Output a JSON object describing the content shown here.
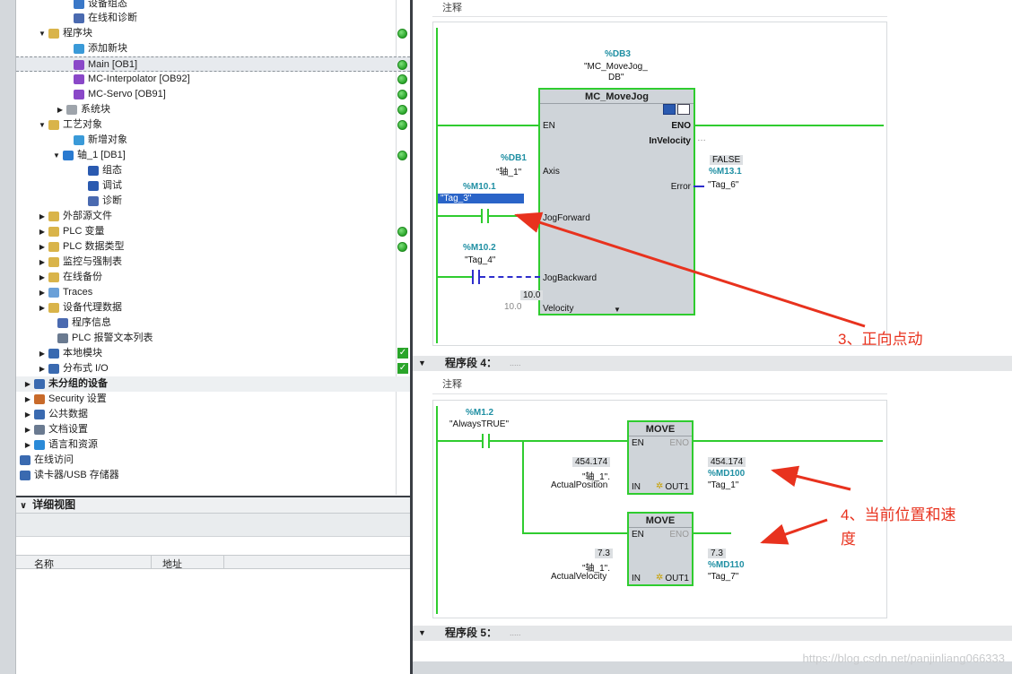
{
  "tree": {
    "items": [
      {
        "label": "设备组态",
        "twisty": "",
        "dot": "",
        "icon": "device-config-icon",
        "icolor": "#3a78c8"
      },
      {
        "label": "在线和诊断",
        "twisty": "",
        "dot": "",
        "icon": "online-diagnostics-icon",
        "icolor": "#4a6ab0"
      },
      {
        "label": "程序块",
        "twisty": "▼",
        "dot": "green",
        "icon": "folder-icon",
        "icolor": "#d9b44a"
      },
      {
        "label": "添加新块",
        "twisty": "",
        "dot": "",
        "icon": "add-block-icon",
        "icolor": "#3a9ad8"
      },
      {
        "label": "Main [OB1]",
        "twisty": "",
        "dot": "green",
        "icon": "ob-block-icon",
        "icolor": "#8a48c8",
        "selected": true
      },
      {
        "label": "MC-Interpolator [OB92]",
        "twisty": "",
        "dot": "green",
        "icon": "ob-block-icon",
        "icolor": "#8a48c8"
      },
      {
        "label": "MC-Servo [OB91]",
        "twisty": "",
        "dot": "green",
        "icon": "ob-block-icon",
        "icolor": "#8a48c8"
      },
      {
        "label": "系统块",
        "twisty": "▶",
        "dot": "green",
        "icon": "folder-icon",
        "icolor": "#9ea4ab"
      },
      {
        "label": "工艺对象",
        "twisty": "▼",
        "dot": "green",
        "icon": "folder-icon",
        "icolor": "#d9b44a"
      },
      {
        "label": "新增对象",
        "twisty": "",
        "dot": "",
        "icon": "add-object-icon",
        "icolor": "#3a9ad8"
      },
      {
        "label": "轴_1 [DB1]",
        "twisty": "▼",
        "dot": "green",
        "icon": "axis-icon",
        "icolor": "#2a7ad0"
      },
      {
        "label": "组态",
        "twisty": "",
        "dot": "",
        "icon": "config-icon",
        "icolor": "#2a5ab0"
      },
      {
        "label": "调试",
        "twisty": "",
        "dot": "",
        "icon": "commissioning-icon",
        "icolor": "#2a5ab0"
      },
      {
        "label": "诊断",
        "twisty": "",
        "dot": "",
        "icon": "diagnostics-icon",
        "icolor": "#4a6ab0"
      },
      {
        "label": "外部源文件",
        "twisty": "▶",
        "dot": "",
        "icon": "folder-icon",
        "icolor": "#d9b44a"
      },
      {
        "label": "PLC 变量",
        "twisty": "▶",
        "dot": "green",
        "icon": "folder-icon",
        "icolor": "#d9b44a"
      },
      {
        "label": "PLC 数据类型",
        "twisty": "▶",
        "dot": "green",
        "icon": "folder-icon",
        "icolor": "#d9b44a"
      },
      {
        "label": "监控与强制表",
        "twisty": "▶",
        "dot": "",
        "icon": "folder-icon",
        "icolor": "#d9b44a"
      },
      {
        "label": "在线备份",
        "twisty": "▶",
        "dot": "",
        "icon": "folder-icon",
        "icolor": "#d9b44a"
      },
      {
        "label": "Traces",
        "twisty": "▶",
        "dot": "",
        "icon": "folder-icon",
        "icolor": "#6aa0d8"
      },
      {
        "label": "设备代理数据",
        "twisty": "▶",
        "dot": "",
        "icon": "folder-icon",
        "icolor": "#d9b44a"
      },
      {
        "label": "程序信息",
        "twisty": "",
        "dot": "",
        "icon": "program-info-icon",
        "icolor": "#4a6ab0"
      },
      {
        "label": "PLC 报警文本列表",
        "twisty": "",
        "dot": "",
        "icon": "alarm-text-icon",
        "icolor": "#6a7a90"
      },
      {
        "label": "本地模块",
        "twisty": "▶",
        "dot": "check",
        "icon": "folder-icon",
        "icolor": "#3a6ab0"
      },
      {
        "label": "分布式 I/O",
        "twisty": "▶",
        "dot": "check",
        "icon": "folder-icon",
        "icolor": "#3a6ab0"
      },
      {
        "label": "未分组的设备",
        "twisty": "▶",
        "dot": "",
        "icon": "ungrouped-devices-icon",
        "icolor": "#3a6ab0",
        "bold": true,
        "group": true
      },
      {
        "label": "Security 设置",
        "twisty": "▶",
        "dot": "",
        "icon": "security-icon",
        "icolor": "#c86a2a"
      },
      {
        "label": "公共数据",
        "twisty": "▶",
        "dot": "",
        "icon": "common-data-icon",
        "icolor": "#3a6ab0"
      },
      {
        "label": "文档设置",
        "twisty": "▶",
        "dot": "",
        "icon": "document-icon",
        "icolor": "#6a7a90"
      },
      {
        "label": "语言和资源",
        "twisty": "▶",
        "dot": "",
        "icon": "language-icon",
        "icolor": "#2a8ad8"
      },
      {
        "label": "在线访问",
        "twisty": "▶",
        "dot": "",
        "icon": "online-access-icon",
        "icolor": "#3a6ab0"
      },
      {
        "label": "读卡器/USB 存储器",
        "twisty": "▶",
        "dot": "",
        "icon": "card-reader-icon",
        "icolor": "#3a6ab0"
      }
    ]
  },
  "detail": {
    "title": "详细视图",
    "col_name": "名称",
    "col_address": "地址"
  },
  "editor": {
    "comment_label": "注释",
    "net3": {
      "instance_addr": "%DB3",
      "instance_sym_1": "\"MC_MoveJog_",
      "instance_sym_2": "DB\"",
      "block_title": "MC_MoveJog",
      "en": "EN",
      "eno": "ENO",
      "invelocity": "InVelocity",
      "invelocity_val": "…",
      "axis_addr": "%DB1",
      "axis_sym": "\"轴_1\"",
      "axis_pin": "Axis",
      "error_val": "FALSE",
      "error_addr": "%M13.1",
      "error_pin": "Error",
      "error_sym": "\"Tag_6\"",
      "fwd_addr": "%M10.1",
      "fwd_sym": "\"Tag_3\"",
      "fwd_pin": "JogForward",
      "bwd_addr": "%M10.2",
      "bwd_sym": "\"Tag_4\"",
      "bwd_pin": "JogBackward",
      "vel_val": "10.0",
      "vel_const": "10.0",
      "vel_pin": "Velocity"
    },
    "seg4": {
      "label": "程序段 4：",
      "dots": "....."
    },
    "net4": {
      "contact_addr": "%M1.2",
      "contact_sym": "\"AlwaysTRUE\"",
      "move_title": "MOVE",
      "en": "EN",
      "eno": "ENO",
      "in": "IN",
      "out1": "OUT1",
      "pos_val": "454.174",
      "pos_sym": "\"轴_1\".",
      "pos_member": "ActualPosition",
      "pos_out_val": "454.174",
      "pos_out_addr": "%MD100",
      "pos_out_sym": "\"Tag_1\"",
      "vel_val": "7.3",
      "vel_sym": "\"轴_1\".",
      "vel_member": "ActualVelocity",
      "vel_out_val": "7.3",
      "vel_out_addr": "%MD110",
      "vel_out_sym": "\"Tag_7\""
    },
    "seg5": {
      "label": "程序段 5：",
      "dots": "....."
    }
  },
  "annotations": {
    "a3": "3、正向点动",
    "a4_line1": "4、当前位置和速",
    "a4_line2": "度",
    "color": "#e8321e"
  },
  "watermark": "https://blog.csdn.net/panjinliang066333"
}
